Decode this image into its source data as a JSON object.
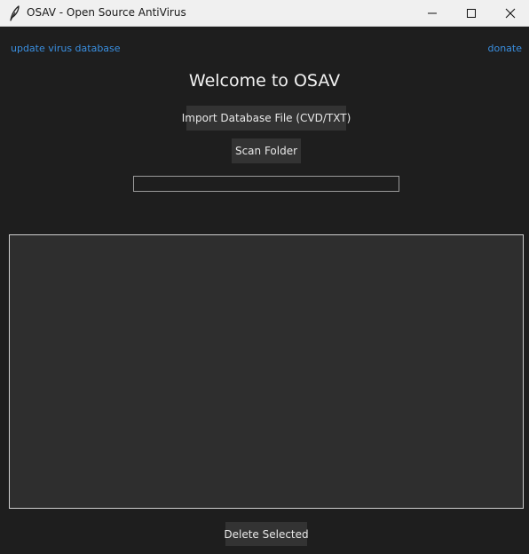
{
  "window": {
    "title": "OSAV - Open Source AntiVirus",
    "app_icon": "feather-icon"
  },
  "links": {
    "update": "update virus database",
    "donate": "donate"
  },
  "main": {
    "heading": "Welcome to OSAV",
    "import_button": "Import Database File (CVD/TXT)",
    "scan_button": "Scan Folder",
    "progress": 0,
    "delete_button": "Delete Selected",
    "results": []
  },
  "colors": {
    "background": "#1e1e1e",
    "link": "#3a8fe0",
    "button": "#333333",
    "list_background": "#2e2e2e"
  }
}
